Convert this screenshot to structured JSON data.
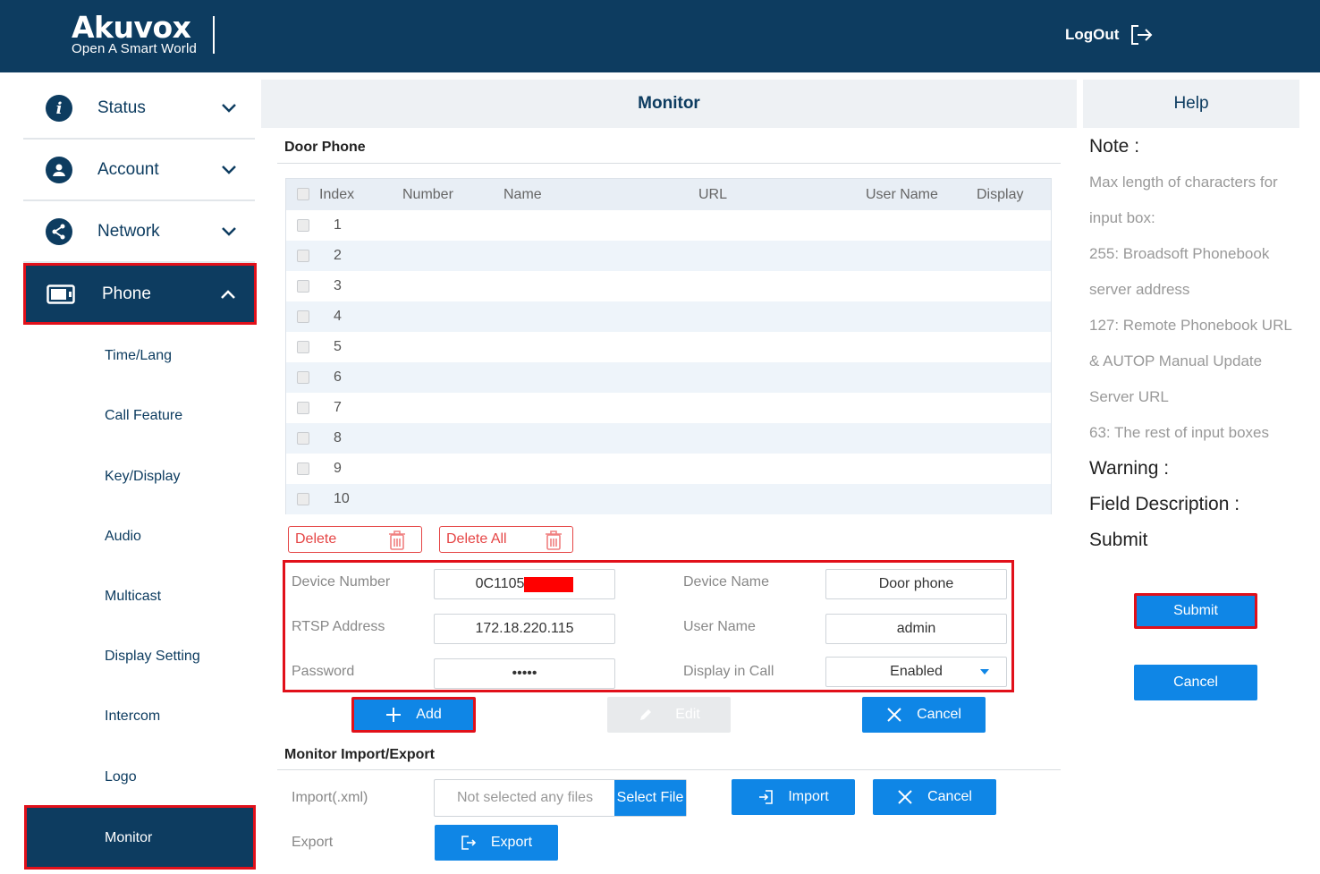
{
  "header": {
    "logo_main": "Akuvox",
    "logo_sub": "Open A Smart World",
    "logout_label": "LogOut"
  },
  "sidebar": {
    "top_items": [
      {
        "label": "Status",
        "icon": "info-icon"
      },
      {
        "label": "Account",
        "icon": "user-icon"
      },
      {
        "label": "Network",
        "icon": "network-icon"
      }
    ],
    "phone_label": "Phone",
    "sub_items": [
      "Time/Lang",
      "Call Feature",
      "Key/Display",
      "Audio",
      "Multicast",
      "Display Setting",
      "Intercom",
      "Logo"
    ],
    "active_label": "Monitor"
  },
  "main": {
    "title": "Monitor",
    "door_phone_section": "Door Phone",
    "table": {
      "columns": [
        "Index",
        "Number",
        "Name",
        "URL",
        "User Name",
        "Display"
      ],
      "rows": [
        "1",
        "2",
        "3",
        "4",
        "5",
        "6",
        "7",
        "8",
        "9",
        "10"
      ]
    },
    "delete_label": "Delete",
    "delete_all_label": "Delete All",
    "form": {
      "device_number_label": "Device Number",
      "device_number_value": "0C1105",
      "device_name_label": "Device Name",
      "device_name_value": "Door phone",
      "rtsp_label": "RTSP Address",
      "rtsp_value": "172.18.220.115",
      "user_name_label": "User Name",
      "user_name_value": "admin",
      "password_label": "Password",
      "password_value": "•••••",
      "display_in_call_label": "Display in Call",
      "display_in_call_value": "Enabled"
    },
    "add_label": "Add",
    "edit_label": "Edit",
    "cancel_label": "Cancel",
    "import_export_section": "Monitor Import/Export",
    "import_label": "Import(.xml)",
    "file_placeholder": "Not selected any files",
    "select_file_label": "Select File",
    "import_button": "Import",
    "import_cancel": "Cancel",
    "export_label": "Export",
    "export_button": "Export"
  },
  "help": {
    "title": "Help",
    "note": "Note :",
    "lines": [
      "Max length of characters for",
      "input box:",
      "255: Broadsoft Phonebook",
      "server address",
      "127: Remote Phonebook URL",
      "& AUTOP Manual Update",
      "Server URL",
      "63: The rest of input boxes"
    ],
    "warning": "Warning :",
    "field_description": "Field Description :",
    "submit_text": "Submit",
    "submit_button": "Submit",
    "cancel_button": "Cancel"
  },
  "colors": {
    "brand_navy": "#0d3c60",
    "accent_blue": "#0f86e6",
    "highlight_red": "#e1101a",
    "danger": "#e54545"
  }
}
